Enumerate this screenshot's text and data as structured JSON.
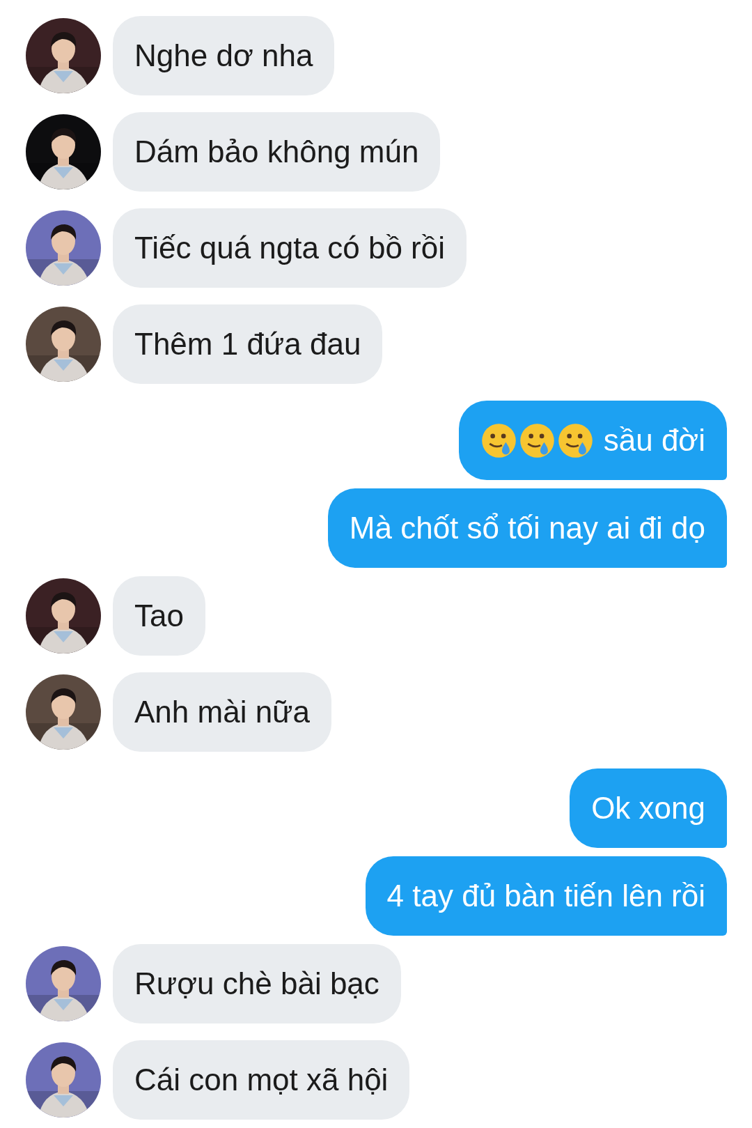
{
  "messages": [
    {
      "kind": "incoming",
      "text": "Nghe dơ nha"
    },
    {
      "kind": "incoming",
      "text": "Dám bảo không mún"
    },
    {
      "kind": "incoming",
      "text": "Tiếc quá ngta có bồ rồi"
    },
    {
      "kind": "incoming",
      "text": "Thêm 1 đứa đau"
    },
    {
      "kind": "outgoing",
      "emoji": [
        {
          "kind": "smiling-tear"
        },
        {
          "kind": "smiling-tear"
        },
        {
          "kind": "smiling-tear"
        }
      ],
      "text": "sầu đời"
    },
    {
      "kind": "outgoing",
      "text": "Mà chốt sổ tối nay ai đi dọ"
    },
    {
      "kind": "incoming",
      "text": "Tao"
    },
    {
      "kind": "incoming",
      "text": "Anh mài nữa"
    },
    {
      "kind": "outgoing",
      "text": "Ok xong"
    },
    {
      "kind": "outgoing",
      "text": "4 tay đủ bàn tiến lên rồi"
    },
    {
      "kind": "incoming",
      "text": "Rượu chè bài bạc"
    },
    {
      "kind": "incoming",
      "text": "Cái con mọt xã hội"
    }
  ]
}
